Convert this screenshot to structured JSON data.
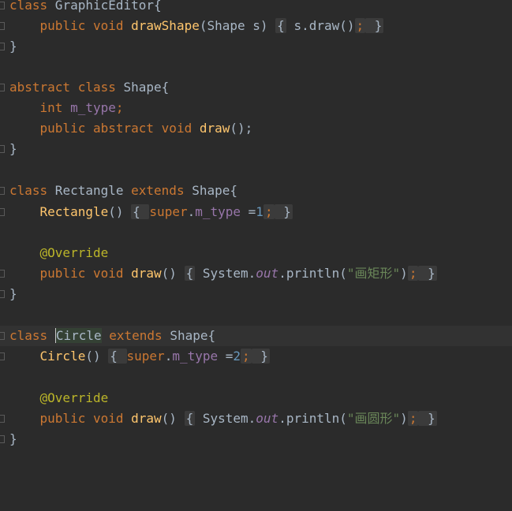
{
  "code": {
    "l1": [
      "class",
      " GraphicEditor{"
    ],
    "l2": [
      "public",
      "void",
      "drawShape",
      "(Shape s) ",
      "{",
      " s.draw()",
      ";",
      " }"
    ],
    "l3": [
      "}"
    ],
    "l5": [
      "abstract",
      "class",
      " Shape{"
    ],
    "l6": [
      "int",
      "m_type",
      ";"
    ],
    "l7": [
      "public",
      "abstract",
      "void",
      "draw",
      "();"
    ],
    "l8": [
      "}"
    ],
    "l10": [
      "class",
      " Rectangle ",
      "extends",
      " Shape{"
    ],
    "l11": [
      "Rectangle",
      "() ",
      "{",
      "super",
      ".",
      "m_type",
      " =",
      "1",
      ";",
      " }"
    ],
    "l13": [
      "@Override"
    ],
    "l14": [
      "public",
      "void",
      "draw",
      "() ",
      "{",
      " System.",
      "out",
      ".println(",
      "\"画矩形\"",
      ")",
      ";",
      " }"
    ],
    "l15": [
      "}"
    ],
    "l17": [
      "class",
      " ",
      "Circle",
      " ",
      "extends",
      " Shape{"
    ],
    "l18": [
      "Circle",
      "() ",
      "{",
      "super",
      ".",
      "m_type",
      " =",
      "2",
      ";",
      " }"
    ],
    "l20": [
      "@Override"
    ],
    "l21": [
      "public",
      "void",
      "draw",
      "() ",
      "{",
      " System.",
      "out",
      ".println(",
      "\"画圆形\"",
      ")",
      ";",
      " }"
    ],
    "l22": [
      "}"
    ]
  },
  "colors": {
    "background": "#2b2b2b",
    "keyword": "#cc7832",
    "method": "#ffc66d",
    "field": "#9876aa",
    "number": "#6897bb",
    "string": "#6a8759",
    "annotation": "#bbb529",
    "text": "#a9b7c6"
  }
}
